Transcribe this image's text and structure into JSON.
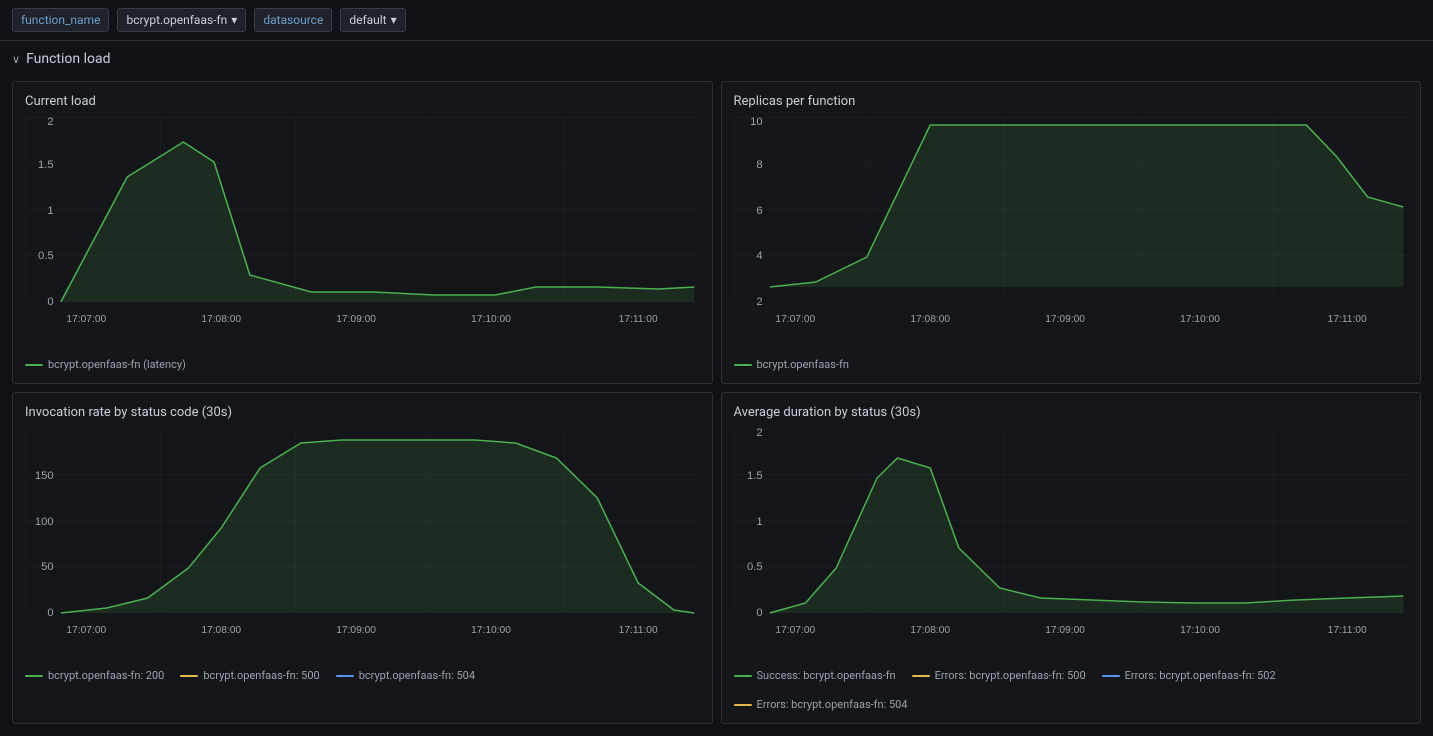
{
  "topbar": {
    "function_name_label": "function_name",
    "function_value": "bcrypt.openfaas-fn",
    "datasource_label": "datasource",
    "datasource_value": "default"
  },
  "section": {
    "title": "Function load",
    "collapse_icon": "chevron-down"
  },
  "charts": {
    "current_load": {
      "title": "Current load",
      "legend": [
        {
          "label": "bcrypt.openfaas-fn (latency)",
          "color": "#4caf50"
        }
      ],
      "y_labels": [
        "0",
        "0.5",
        "1",
        "1.5",
        "2"
      ],
      "x_labels": [
        "17:07:00",
        "17:08:00",
        "17:09:00",
        "17:10:00",
        "17:11:00"
      ]
    },
    "replicas_per_function": {
      "title": "Replicas per function",
      "legend": [
        {
          "label": "bcrypt.openfaas-fn",
          "color": "#4caf50"
        }
      ],
      "y_labels": [
        "2",
        "4",
        "6",
        "8",
        "10"
      ],
      "x_labels": [
        "17:07:00",
        "17:08:00",
        "17:09:00",
        "17:10:00",
        "17:11:00"
      ]
    },
    "invocation_rate": {
      "title": "Invocation rate by status code (30s)",
      "legend": [
        {
          "label": "bcrypt.openfaas-fn: 200",
          "color": "#4caf50"
        },
        {
          "label": "bcrypt.openfaas-fn: 500",
          "color": "#e8b84b"
        },
        {
          "label": "bcrypt.openfaas-fn: 504",
          "color": "#5794f2"
        }
      ],
      "y_labels": [
        "0",
        "50",
        "100",
        "150"
      ],
      "x_labels": [
        "17:07:00",
        "17:08:00",
        "17:09:00",
        "17:10:00",
        "17:11:00"
      ]
    },
    "avg_duration": {
      "title": "Average duration by status (30s)",
      "legend": [
        {
          "label": "Success: bcrypt.openfaas-fn",
          "color": "#4caf50"
        },
        {
          "label": "Errors: bcrypt.openfaas-fn: 500",
          "color": "#e8b84b"
        },
        {
          "label": "Errors: bcrypt.openfaas-fn: 502",
          "color": "#5794f2"
        },
        {
          "label": "Errors: bcrypt.openfaas-fn: 504",
          "color": "#e8b84b"
        }
      ],
      "y_labels": [
        "0",
        "0.5",
        "1",
        "1.5",
        "2"
      ],
      "x_labels": [
        "17:07:00",
        "17:08:00",
        "17:09:00",
        "17:10:00",
        "17:11:00"
      ]
    }
  }
}
